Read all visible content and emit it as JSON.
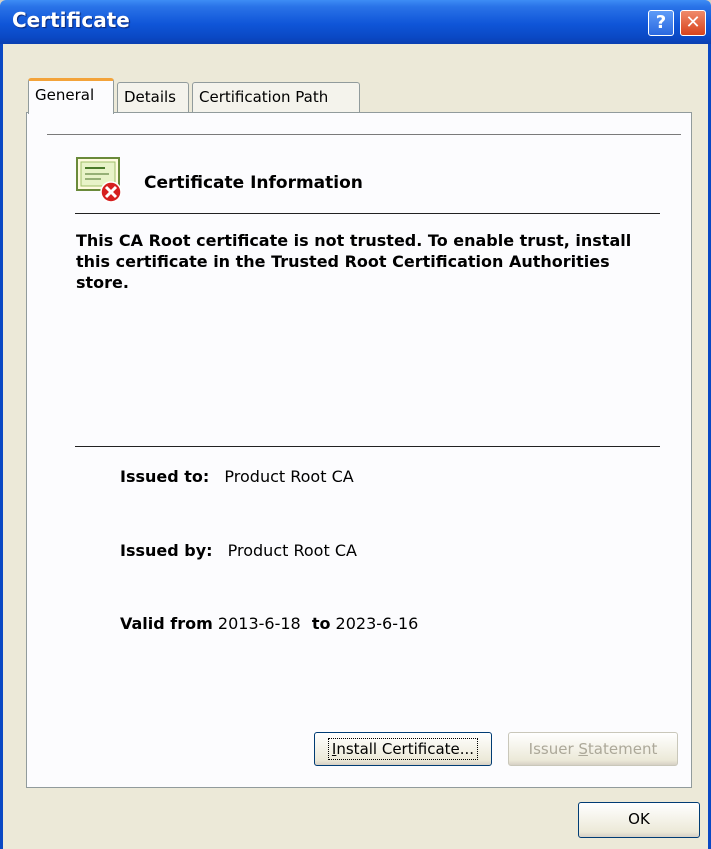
{
  "window": {
    "title": "Certificate",
    "help_label": "?",
    "close_label": "✕"
  },
  "tabs": [
    {
      "label": "General",
      "active": true
    },
    {
      "label": "Details",
      "active": false
    },
    {
      "label": "Certification Path",
      "active": false
    }
  ],
  "info": {
    "heading": "Certificate Information",
    "icon": "certificate-error-icon",
    "warning": "This CA Root certificate is not trusted. To enable trust, install this certificate in the Trusted Root Certification Authorities store."
  },
  "fields": {
    "issued_to_label": "Issued to:",
    "issued_to_value": "Product Root CA",
    "issued_by_label": "Issued by:",
    "issued_by_value": "Product Root CA",
    "valid_from_label": "Valid from",
    "valid_from_value": "2013-6-18",
    "to_label": "to",
    "valid_to_value": "2023-6-16"
  },
  "buttons": {
    "install_accel": "I",
    "install_rest": "nstall Certificate...",
    "issuer_pre": "Issuer ",
    "issuer_accel": "S",
    "issuer_post": "tatement",
    "ok": "OK"
  },
  "colors": {
    "titlebar": "#0a48c4",
    "dialog": "#ece9d8",
    "close": "#d8431c"
  }
}
